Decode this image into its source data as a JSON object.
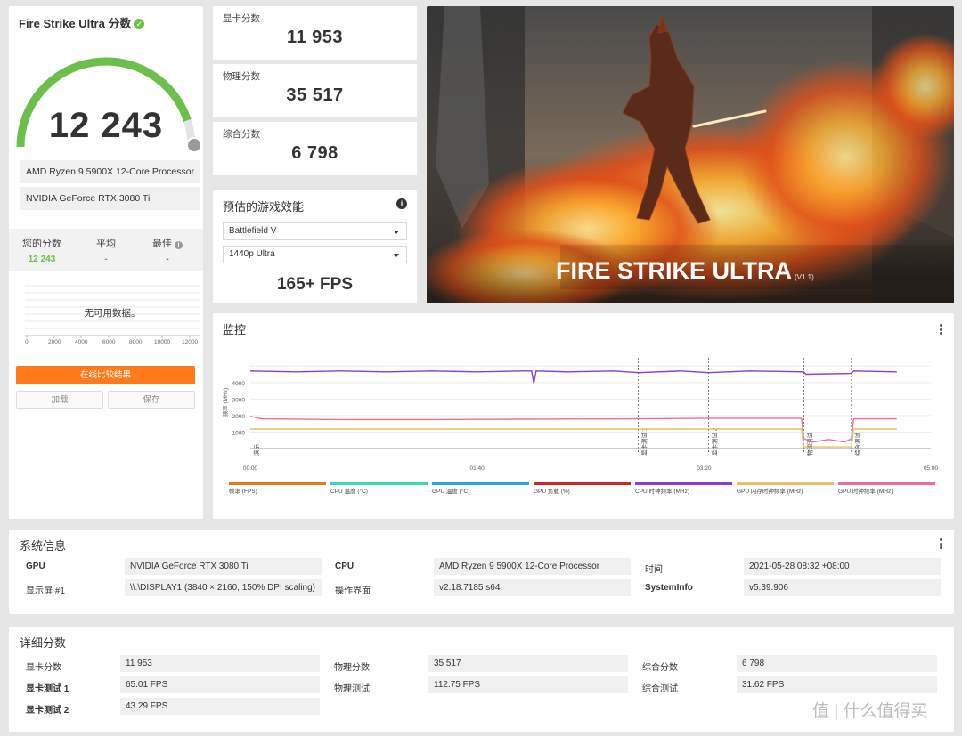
{
  "score_panel": {
    "title": "Fire Strike Ultra 分数",
    "total_score": "12 243",
    "gauge_fraction": 0.9,
    "cpu": "AMD Ryzen 9 5900X 12-Core Processor",
    "gpu": "NVIDIA GeForce RTX 3080 Ti",
    "stats": {
      "yours_label": "您的分数",
      "yours_value": "12 243",
      "avg_label": "平均",
      "avg_value": "-",
      "best_label": "最佳",
      "best_value": "-"
    },
    "no_data": "无可用数据。",
    "dist_ticks": [
      "0",
      "2000",
      "4000",
      "6000",
      "8000",
      "10000",
      "12000"
    ],
    "compare_button": "在线比较结果",
    "load_button": "加载",
    "save_button": "保存"
  },
  "scores": {
    "graphics_label": "显卡分数",
    "graphics_value": "11 953",
    "physics_label": "物理分数",
    "physics_value": "35 517",
    "combined_label": "综合分数",
    "combined_value": "6 798"
  },
  "game_perf": {
    "title": "预估的游戏效能",
    "game": "Battlefield V",
    "preset": "1440p Ultra",
    "fps": "165+ FPS"
  },
  "hero": {
    "title": "FIRE STRIKE ULTRA",
    "version": "(V1.1)"
  },
  "monitor": {
    "title": "监控",
    "y_label": "频率 (MHz)",
    "y_ticks": [
      "1000",
      "2000",
      "3000",
      "4000"
    ],
    "x_ticks": [
      "00:00",
      "01:40",
      "03:20",
      "05:00"
    ],
    "markers": [
      "演示",
      "显卡测试 1",
      "显卡测试 2",
      "物理测试",
      "综合测试"
    ],
    "legend": [
      {
        "label": "帧率 (FPS)",
        "color": "#e8781e"
      },
      {
        "label": "CPU 温度 (°C)",
        "color": "#3ad6c2"
      },
      {
        "label": "GPU 温度 (°C)",
        "color": "#2aa6e6"
      },
      {
        "label": "GPU 负载 (%)",
        "color": "#c82a2a"
      },
      {
        "label": "CPU 时钟频率 (MHz)",
        "color": "#8a3ed0"
      },
      {
        "label": "GPU 内存时钟频率 (MHz)",
        "color": "#e8c06a"
      },
      {
        "label": "GPU 时钟频率 (MHz)",
        "color": "#e8709e"
      }
    ]
  },
  "chart_data": {
    "type": "line",
    "x_unit": "seconds",
    "xlim": [
      0,
      300
    ],
    "ylim": [
      0,
      5500
    ],
    "markers_s": [
      0,
      171,
      202,
      244,
      265
    ],
    "series": [
      {
        "name": "CPU 时钟频率 (MHz)",
        "x": [
          0,
          20,
          40,
          60,
          80,
          100,
          120,
          124,
          125,
          126,
          140,
          160,
          171,
          190,
          202,
          220,
          244,
          245,
          265,
          266,
          285
        ],
        "values": [
          4700,
          4650,
          4700,
          4650,
          4700,
          4650,
          4700,
          4700,
          3950,
          4700,
          4650,
          4700,
          4600,
          4700,
          4600,
          4700,
          4650,
          4500,
          4550,
          4700,
          4650
        ]
      },
      {
        "name": "GPU 时钟频率 (MHz)",
        "x": [
          0,
          5,
          40,
          80,
          120,
          171,
          202,
          243,
          244,
          248,
          255,
          262,
          265,
          266,
          285
        ],
        "values": [
          1950,
          1800,
          1760,
          1760,
          1780,
          1800,
          1840,
          1840,
          600,
          400,
          550,
          400,
          600,
          1800,
          1800
        ]
      },
      {
        "name": "GPU 内存时钟频率 (MHz)",
        "x": [
          0,
          243,
          244,
          265,
          266,
          285
        ],
        "values": [
          1188,
          1188,
          100,
          100,
          1188,
          1188
        ]
      }
    ]
  },
  "system_info": {
    "title": "系统信息",
    "rows": [
      [
        {
          "key": "GPU",
          "value": "NVIDIA GeForce RTX 3080 Ti"
        },
        {
          "key": "CPU",
          "value": "AMD Ryzen 9 5900X 12-Core Processor"
        },
        {
          "key": "时间",
          "value": "2021-05-28 08:32 +08:00"
        }
      ],
      [
        {
          "key": "显示屏 #1",
          "value": "\\\\.\\DISPLAY1 (3840 × 2160, 150% DPI scaling)"
        },
        {
          "key": "操作界面",
          "value": "v2.18.7185 s64"
        },
        {
          "key": "SystemInfo",
          "value": "v5.39.906"
        }
      ]
    ]
  },
  "detail_scores": {
    "title": "详细分数",
    "rows": [
      [
        {
          "key": "显卡分数",
          "value": "11 953"
        },
        {
          "key": "物理分数",
          "value": "35 517"
        },
        {
          "key": "综合分数",
          "value": "6 798"
        }
      ],
      [
        {
          "key": "显卡测试 1",
          "value": "65.01 FPS"
        },
        {
          "key": "物理测试",
          "value": "112.75 FPS"
        },
        {
          "key": "综合测试",
          "value": "31.62 FPS"
        }
      ],
      [
        {
          "key": "显卡测试 2",
          "value": "43.29 FPS"
        }
      ]
    ]
  },
  "watermark": "值 | 什么值得买"
}
